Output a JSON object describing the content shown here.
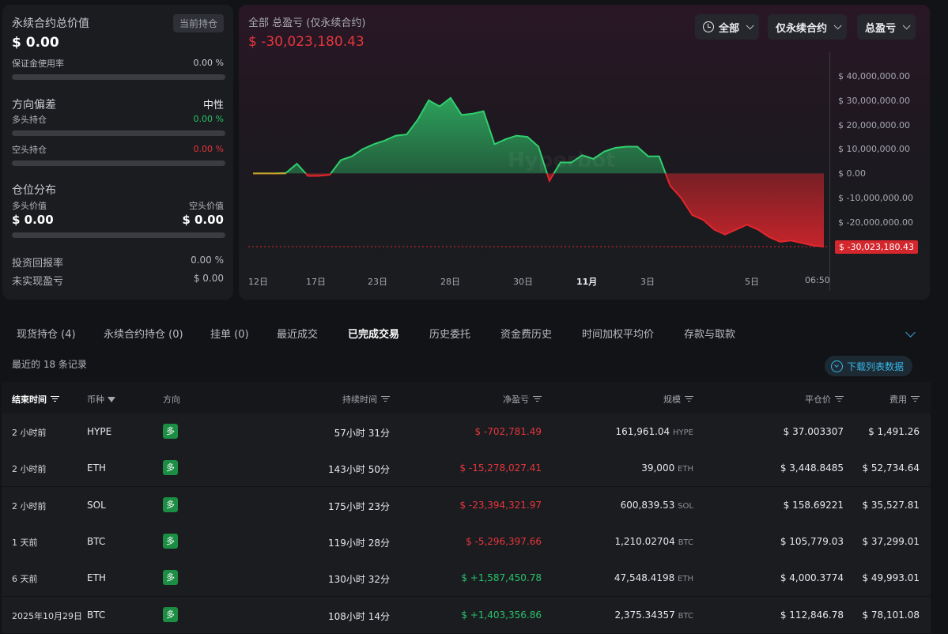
{
  "summary": {
    "title": "永续合约总价值",
    "badge": "当前持仓",
    "total_value": "$ 0.00",
    "margin_usage_label": "保证金使用率",
    "margin_usage_value": "0.00 %",
    "direction_label": "方向偏差",
    "direction_value": "中性",
    "long_label": "多头持仓",
    "long_value": "0.00 %",
    "short_label": "空头持仓",
    "short_value": "0.00 %",
    "distribution_label": "仓位分布",
    "long_value_label": "多头价值",
    "long_value_amount": "$ 0.00",
    "short_value_label": "空头价值",
    "short_value_amount": "$ 0.00",
    "roi_label": "投资回报率",
    "roi_value": "0.00 %",
    "unrealized_label": "未实现盈亏",
    "unrealized_value": "$ 0.00"
  },
  "chart_panel": {
    "title": "全部 总盈亏 (仅永续合约)",
    "total": "$ -30,023,180.43",
    "filters": [
      "全部",
      "仅永续合约",
      "总盈亏"
    ],
    "watermark": "Hyperbot"
  },
  "chart_data": {
    "type": "area",
    "x_tick_labels": [
      "12日",
      "17日",
      "23日",
      "28日",
      "30日",
      "11月",
      "3日",
      "5日",
      "06:50"
    ],
    "y_tick_labels": [
      "$ 40,000,000.00",
      "$ 30,000,000.00",
      "$ 20,000,000.00",
      "$ 10,000,000.00",
      "$ 0.00",
      "$ -10,000,000.00",
      "$ -20,000,000.00"
    ],
    "ylim": [
      -30000000,
      40000000
    ],
    "last_value_label": "$ -30,023,180.43",
    "colors": {
      "positive": "#2fd06e",
      "negative": "#e3262d",
      "zero_line": "#c9a227"
    },
    "values": [
      0,
      0,
      0,
      200000,
      4000000,
      -1000000,
      -1000000,
      -500000,
      5500000,
      7000000,
      10000000,
      12000000,
      13500000,
      15500000,
      16000000,
      22000000,
      30000000,
      27500000,
      31000000,
      24000000,
      24500000,
      25500000,
      12000000,
      14000000,
      15500000,
      15000000,
      11000000,
      -3000000,
      4500000,
      4500000,
      7500000,
      6000000,
      9000000,
      10500000,
      11000000,
      11000000,
      7000000,
      7000000,
      -5000000,
      -10000000,
      -17000000,
      -19000000,
      -23000000,
      -25000000,
      -23000000,
      -21000000,
      -23000000,
      -26000000,
      -28000000,
      -27500000,
      -28500000,
      -29500000,
      -30000000
    ],
    "grid": false,
    "legend": "none"
  },
  "tabs": [
    {
      "label": "现货持仓 (4)"
    },
    {
      "label": "永续合约持仓 (0)"
    },
    {
      "label": "挂单 (0)"
    },
    {
      "label": "最近成交"
    },
    {
      "label": "已完成交易"
    },
    {
      "label": "历史委托"
    },
    {
      "label": "资金费历史"
    },
    {
      "label": "时间加权平均价"
    },
    {
      "label": "存款与取款"
    }
  ],
  "active_tab": "已完成交易",
  "table": {
    "record_count": "最近的 18 条记录",
    "download_label": "下载列表数据",
    "headers": [
      "结束时间",
      "币种",
      "方向",
      "持续时间",
      "净盈亏",
      "规模",
      "平仓价",
      "费用"
    ],
    "rows": [
      {
        "time": "2 小时前",
        "coin": "HYPE",
        "dir": "多",
        "duration": "57小时 31分",
        "pnl": "$ -702,781.49",
        "pnl_sign": "neg",
        "size": "161,961.04",
        "unit": "HYPE",
        "price": "$ 37.003307",
        "fee": "$ 1,491.26"
      },
      {
        "time": "2 小时前",
        "coin": "ETH",
        "dir": "多",
        "duration": "143小时 50分",
        "pnl": "$ -15,278,027.41",
        "pnl_sign": "neg",
        "size": "39,000",
        "unit": "ETH",
        "price": "$ 3,448.8485",
        "fee": "$ 52,734.64"
      },
      {
        "time": "2 小时前",
        "coin": "SOL",
        "dir": "多",
        "duration": "175小时 23分",
        "pnl": "$ -23,394,321.97",
        "pnl_sign": "neg",
        "size": "600,839.53",
        "unit": "SOL",
        "price": "$ 158.69221",
        "fee": "$ 35,527.81"
      },
      {
        "time": "1 天前",
        "coin": "BTC",
        "dir": "多",
        "duration": "119小时 28分",
        "pnl": "$ -5,296,397.66",
        "pnl_sign": "neg",
        "size": "1,210.02704",
        "unit": "BTC",
        "price": "$ 105,779.03",
        "fee": "$ 37,299.01"
      },
      {
        "time": "6 天前",
        "coin": "ETH",
        "dir": "多",
        "duration": "130小时 32分",
        "pnl": "$ +1,587,450.78",
        "pnl_sign": "pos",
        "size": "47,548.4198",
        "unit": "ETH",
        "price": "$ 4,000.3774",
        "fee": "$ 49,993.01"
      },
      {
        "time": "2025年10月29日",
        "coin": "BTC",
        "dir": "多",
        "duration": "108小时 14分",
        "pnl": "$ +1,403,356.86",
        "pnl_sign": "pos",
        "size": "2,375.34357",
        "unit": "BTC",
        "price": "$ 112,846.78",
        "fee": "$ 78,101.08"
      }
    ]
  }
}
